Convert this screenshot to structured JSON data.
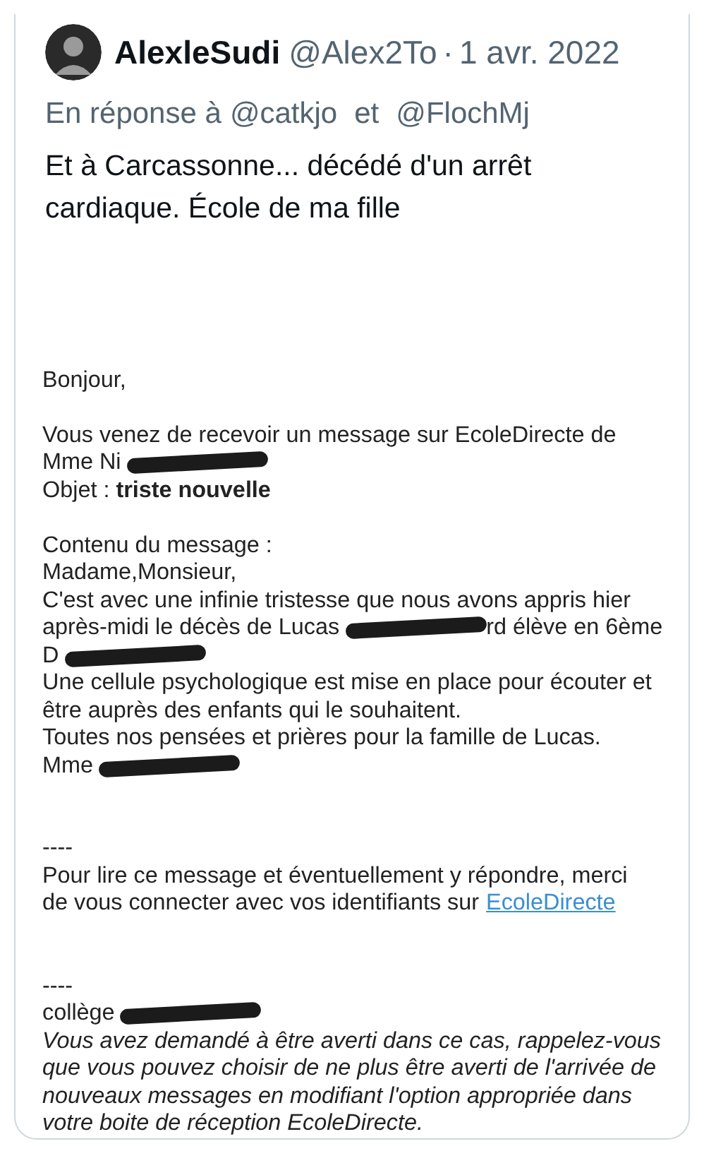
{
  "tweet": {
    "author": "AlexleSudi",
    "handle": "@Alex2To",
    "separator": "·",
    "date": "1 avr. 2022",
    "reply_to": {
      "prefix": "En réponse à",
      "users": [
        "@catkjo",
        "@FlochMj"
      ],
      "conjunction": "et"
    },
    "text": "Et à Carcassonne... décédé d'un arrêt cardiaque. École de ma fille",
    "attachment": {
      "lines": [
        {
          "kind": "blank"
        },
        {
          "kind": "blank"
        },
        {
          "kind": "blank"
        },
        {
          "kind": "plain",
          "segments": [
            {
              "kind": "text",
              "text": "Bonjour,"
            }
          ]
        },
        {
          "kind": "blank"
        },
        {
          "kind": "plain",
          "segments": [
            {
              "kind": "text",
              "text": "Vous venez de recevoir un message sur EcoleDirecte de"
            }
          ]
        },
        {
          "kind": "plain",
          "segments": [
            {
              "kind": "text",
              "text": "Mme Ni"
            },
            {
              "kind": "redaction"
            }
          ]
        },
        {
          "kind": "plain",
          "segments": [
            {
              "kind": "text",
              "text": "Objet : **triste nouvelle**"
            }
          ]
        },
        {
          "kind": "blank"
        },
        {
          "kind": "plain",
          "segments": [
            {
              "kind": "text",
              "text": "Contenu du message :"
            }
          ]
        },
        {
          "kind": "plain",
          "segments": [
            {
              "kind": "text",
              "text": "Madame,Monsieur,"
            }
          ]
        },
        {
          "kind": "plain",
          "segments": [
            {
              "kind": "text",
              "text": "C'est avec une infinie tristesse que nous avons appris hier"
            }
          ]
        },
        {
          "kind": "plain",
          "segments": [
            {
              "kind": "text",
              "text": "après-midi le décès de Lucas"
            },
            {
              "kind": "redaction"
            },
            {
              "kind": "text",
              "text": "rd élève en 6ème"
            }
          ]
        },
        {
          "kind": "plain",
          "segments": [
            {
              "kind": "text",
              "text": "D"
            },
            {
              "kind": "redaction"
            }
          ]
        },
        {
          "kind": "plain",
          "segments": [
            {
              "kind": "text",
              "text": "Une cellule psychologique est mise en place pour écouter et"
            }
          ]
        },
        {
          "kind": "plain",
          "segments": [
            {
              "kind": "text",
              "text": "être auprès des enfants qui le souhaitent."
            }
          ]
        },
        {
          "kind": "plain",
          "segments": [
            {
              "kind": "text",
              "text": "Toutes nos pensées et prières pour la famille de Lucas."
            }
          ]
        },
        {
          "kind": "plain",
          "segments": [
            {
              "kind": "text",
              "text": "Mme"
            },
            {
              "kind": "redaction"
            }
          ]
        },
        {
          "kind": "blank"
        },
        {
          "kind": "blank"
        },
        {
          "kind": "plain",
          "segments": [
            {
              "kind": "text",
              "text": "----"
            }
          ]
        },
        {
          "kind": "plain",
          "segments": [
            {
              "kind": "text",
              "text": "Pour lire ce message et éventuellement y répondre, merci"
            }
          ]
        },
        {
          "kind": "plain",
          "segments": [
            {
              "kind": "text",
              "text": "de vous connecter avec vos identifiants sur"
            },
            {
              "kind": "link",
              "text": "EcoleDirecte"
            }
          ]
        },
        {
          "kind": "blank"
        },
        {
          "kind": "blank"
        },
        {
          "kind": "plain",
          "segments": [
            {
              "kind": "text",
              "text": "----"
            }
          ]
        },
        {
          "kind": "plain",
          "segments": [
            {
              "kind": "text",
              "text": "collège"
            },
            {
              "kind": "redaction"
            }
          ]
        },
        {
          "kind": "italic",
          "segments": [
            {
              "kind": "text",
              "text": "Vous avez demandé à être averti dans ce cas, rappelez-vous"
            }
          ]
        },
        {
          "kind": "italic",
          "segments": [
            {
              "kind": "text",
              "text": "que vous pouvez choisir de ne plus être averti de l'arrivée de"
            }
          ]
        },
        {
          "kind": "italic",
          "segments": [
            {
              "kind": "text",
              "text": "nouveaux messages en modifiant l'option appropriée dans"
            }
          ]
        },
        {
          "kind": "italic",
          "segments": [
            {
              "kind": "text",
              "text": "votre boite de réception EcoleDirecte."
            }
          ]
        }
      ]
    }
  }
}
